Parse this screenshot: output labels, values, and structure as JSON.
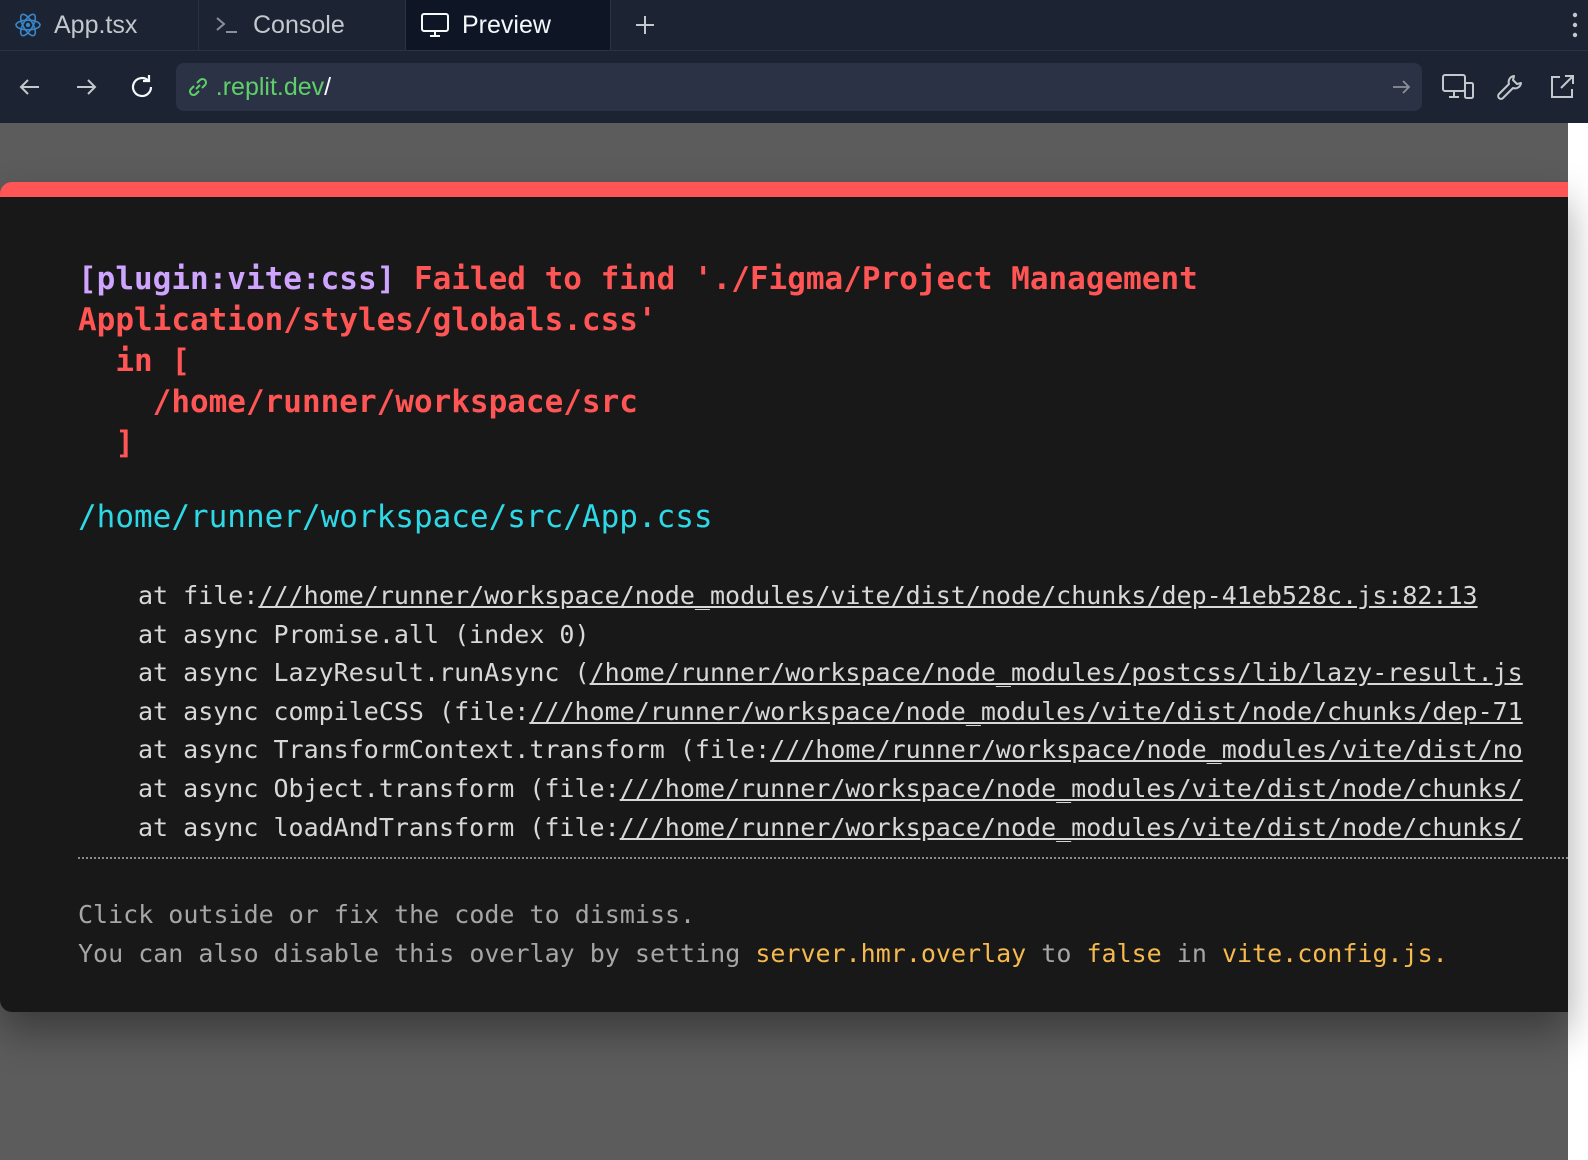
{
  "tabs": [
    {
      "label": "App.tsx",
      "icon": "react-icon"
    },
    {
      "label": "Console",
      "icon": "terminal-icon"
    },
    {
      "label": "Preview",
      "icon": "monitor-icon"
    }
  ],
  "url": {
    "domain": ".replit.dev",
    "path": "/"
  },
  "error": {
    "plugin": "[plugin:vite:css]",
    "message_line1": " Failed to find './Figma/Project Management",
    "message_rest": "Application/styles/globals.css'\n  in [\n    /home/runner/workspace/src\n  ]",
    "file": "/home/runner/workspace/src/App.css",
    "stack": [
      {
        "prefix": "at file:",
        "link": "///home/runner/workspace/node_modules/vite/dist/node/chunks/dep-41eb528c.js:82:13"
      },
      {
        "prefix": "at async Promise.all (index 0)",
        "link": ""
      },
      {
        "prefix": "at async LazyResult.runAsync (",
        "link": "/home/runner/workspace/node_modules/postcss/lib/lazy-result.js"
      },
      {
        "prefix": "at async compileCSS (file:",
        "link": "///home/runner/workspace/node_modules/vite/dist/node/chunks/dep-71"
      },
      {
        "prefix": "at async TransformContext.transform (file:",
        "link": "///home/runner/workspace/node_modules/vite/dist/no"
      },
      {
        "prefix": "at async Object.transform (file:",
        "link": "///home/runner/workspace/node_modules/vite/dist/node/chunks/"
      },
      {
        "prefix": "at async loadAndTransform (file:",
        "link": "///home/runner/workspace/node_modules/vite/dist/node/chunks/"
      }
    ],
    "tip_line1": "Click outside or fix the code to dismiss.",
    "tip_a": "You can also disable this overlay by setting ",
    "tip_code1": "server.hmr.overlay",
    "tip_b": " to ",
    "tip_code2": "false",
    "tip_c": " in ",
    "tip_code3": "vite.config.js",
    "tip_d": "."
  },
  "colors": {
    "accent_bar": "#ff5555",
    "plugin_text": "#cfa4ff",
    "file_path": "#2dd9e6",
    "url_domain": "#5fcf6a",
    "code_hint": "#f6b94d"
  }
}
